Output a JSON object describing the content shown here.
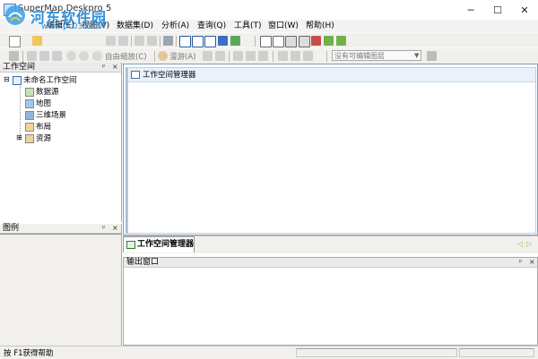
{
  "window": {
    "title": "SuperMap Deskpro 5",
    "minimize_glyph": "─",
    "maximize_glyph": "☐",
    "close_glyph": "✕"
  },
  "watermark": {
    "name": "河东软件园",
    "url": "www.pc0359.cn"
  },
  "menu": [
    {
      "label": "编辑(E)"
    },
    {
      "label": "视图(V)"
    },
    {
      "label": "数据集(D)"
    },
    {
      "label": "分析(A)"
    },
    {
      "label": "查询(Q)"
    },
    {
      "label": "工具(T)"
    },
    {
      "label": "窗口(W)"
    },
    {
      "label": "帮助(H)"
    }
  ],
  "toolbar2": {
    "free_zoom": "自由缩放(C)",
    "pan": "漫游(A)",
    "layer_select_placeholder": "没有可编辑图层"
  },
  "workspace_panel": {
    "title": "工作空间",
    "pin": "ᵖ",
    "close": "×",
    "root": "未命名工作空间",
    "items": [
      {
        "label": "数据源"
      },
      {
        "label": "地图"
      },
      {
        "label": "三维场景"
      },
      {
        "label": "布局"
      },
      {
        "label": "资源"
      }
    ],
    "expand_glyph": "⊟",
    "collapse_glyph": "⊞"
  },
  "legend_panel": {
    "title": "图例",
    "pin": "ᵖ",
    "close": "×"
  },
  "doc": {
    "title": "工作空间管理器"
  },
  "tab": {
    "label": "工作空间管理器",
    "prev_glyph": "◁",
    "next_glyph": "▷"
  },
  "output_panel": {
    "title": "输出窗口",
    "pin": "ᵖ",
    "close": "×"
  },
  "status": {
    "help_text": "按 F1获得帮助"
  },
  "colors": {
    "watermark_blue": "#2f8fd8",
    "panel_bg": "#f1f0ec",
    "frame_blue": "#7f9db9"
  }
}
